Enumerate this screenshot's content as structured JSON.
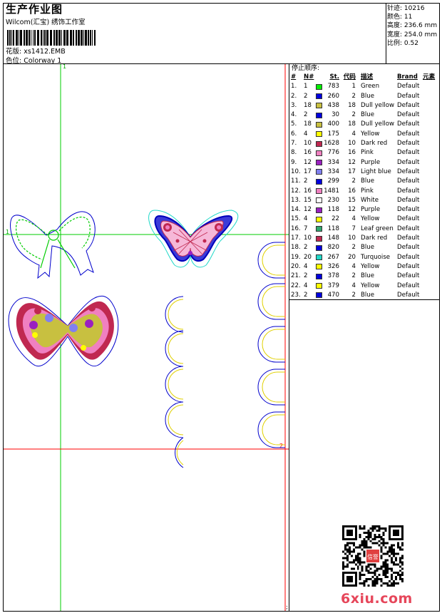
{
  "header": {
    "title": "生产作业图",
    "company": "Wilcom(汇宝) 绣饰工作室",
    "design_label": "花版:",
    "design_value": "xs1412.EMB",
    "colorway_label": "色位:",
    "colorway_value": "Colorway 1"
  },
  "stats": [
    {
      "label": "针迹:",
      "value": "10216"
    },
    {
      "label": "颜色:",
      "value": "11"
    },
    {
      "label": "高度:",
      "value": "236.6 mm"
    },
    {
      "label": "宽度:",
      "value": "254.0 mm"
    },
    {
      "label": "比例:",
      "value": "0.52"
    }
  ],
  "canvas": {
    "guide_label_1": "1",
    "guide_label_2": "2",
    "corner_mark": ";"
  },
  "stop_sequence": {
    "label": "停止顺序:",
    "columns": {
      "index": "#",
      "needle": "N#",
      "stitches": "St.",
      "code": "代码",
      "description": "描述",
      "brand": "Brand",
      "element": "元素"
    },
    "rows": [
      {
        "i": "1.",
        "n": "1",
        "color": "#00ee00",
        "st": "783",
        "code": "1",
        "desc": "Green",
        "brand": "Default"
      },
      {
        "i": "2.",
        "n": "2",
        "color": "#0000dd",
        "st": "260",
        "code": "2",
        "desc": "Blue",
        "brand": "Default"
      },
      {
        "i": "3.",
        "n": "18",
        "color": "#c8c040",
        "st": "438",
        "code": "18",
        "desc": "Dull yellow",
        "brand": "Default"
      },
      {
        "i": "4.",
        "n": "2",
        "color": "#0000dd",
        "st": "30",
        "code": "2",
        "desc": "Blue",
        "brand": "Default"
      },
      {
        "i": "5.",
        "n": "18",
        "color": "#c8c040",
        "st": "400",
        "code": "18",
        "desc": "Dull yellow",
        "brand": "Default"
      },
      {
        "i": "6.",
        "n": "4",
        "color": "#ffff00",
        "st": "175",
        "code": "4",
        "desc": "Yellow",
        "brand": "Default"
      },
      {
        "i": "7.",
        "n": "10",
        "color": "#c02850",
        "st": "1628",
        "code": "10",
        "desc": "Dark red",
        "brand": "Default"
      },
      {
        "i": "8.",
        "n": "16",
        "color": "#f080c0",
        "st": "776",
        "code": "16",
        "desc": "Pink",
        "brand": "Default"
      },
      {
        "i": "9.",
        "n": "12",
        "color": "#9a20c0",
        "st": "334",
        "code": "12",
        "desc": "Purple",
        "brand": "Default"
      },
      {
        "i": "10.",
        "n": "17",
        "color": "#8080f0",
        "st": "334",
        "code": "17",
        "desc": "Light blue",
        "brand": "Default"
      },
      {
        "i": "11.",
        "n": "2",
        "color": "#0000dd",
        "st": "299",
        "code": "2",
        "desc": "Blue",
        "brand": "Default"
      },
      {
        "i": "12.",
        "n": "16",
        "color": "#f080c0",
        "st": "1481",
        "code": "16",
        "desc": "Pink",
        "brand": "Default"
      },
      {
        "i": "13.",
        "n": "15",
        "color": "#ffffff",
        "st": "230",
        "code": "15",
        "desc": "White",
        "brand": "Default"
      },
      {
        "i": "14.",
        "n": "12",
        "color": "#9a20c0",
        "st": "118",
        "code": "12",
        "desc": "Purple",
        "brand": "Default"
      },
      {
        "i": "15.",
        "n": "4",
        "color": "#ffff00",
        "st": "22",
        "code": "4",
        "desc": "Yellow",
        "brand": "Default"
      },
      {
        "i": "16.",
        "n": "7",
        "color": "#30a870",
        "st": "118",
        "code": "7",
        "desc": "Leaf green",
        "brand": "Default"
      },
      {
        "i": "17.",
        "n": "10",
        "color": "#c02850",
        "st": "148",
        "code": "10",
        "desc": "Dark red",
        "brand": "Default"
      },
      {
        "i": "18.",
        "n": "2",
        "color": "#0000dd",
        "st": "820",
        "code": "2",
        "desc": "Blue",
        "brand": "Default"
      },
      {
        "i": "19.",
        "n": "20",
        "color": "#20d8c8",
        "st": "267",
        "code": "20",
        "desc": "Turquoise",
        "brand": "Default"
      },
      {
        "i": "20.",
        "n": "4",
        "color": "#ffff00",
        "st": "326",
        "code": "4",
        "desc": "Yellow",
        "brand": "Default"
      },
      {
        "i": "21.",
        "n": "2",
        "color": "#0000dd",
        "st": "378",
        "code": "2",
        "desc": "Blue",
        "brand": "Default"
      },
      {
        "i": "22.",
        "n": "4",
        "color": "#ffff00",
        "st": "379",
        "code": "4",
        "desc": "Yellow",
        "brand": "Default"
      },
      {
        "i": "23.",
        "n": "2",
        "color": "#0000dd",
        "st": "470",
        "code": "2",
        "desc": "Blue",
        "brand": "Default"
      }
    ]
  },
  "watermark": "6xiu.com",
  "qr_stamp": "信誉"
}
